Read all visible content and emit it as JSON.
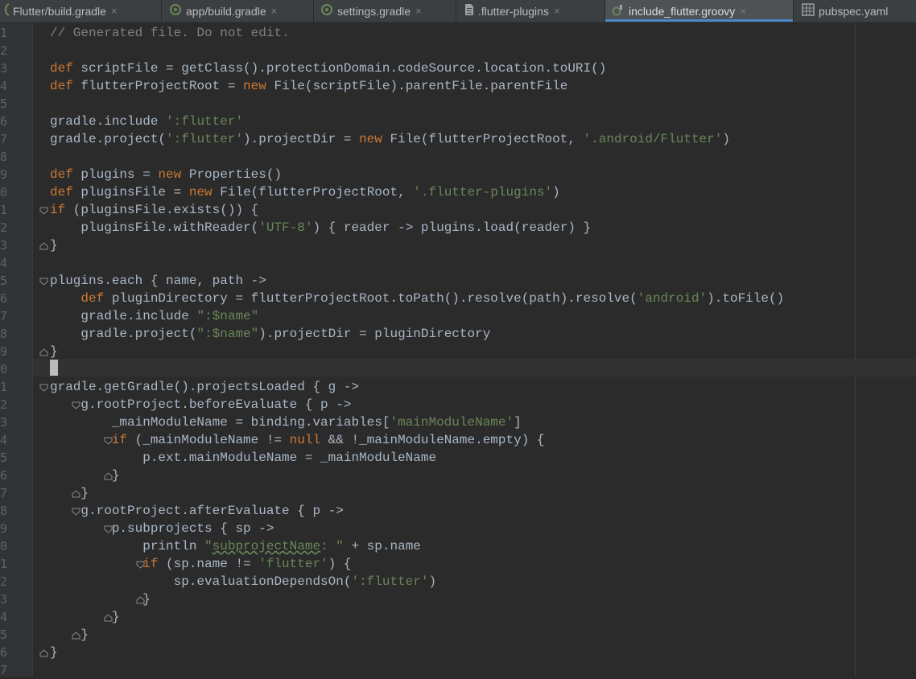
{
  "tabs": [
    {
      "label": "Flutter/build.gradle",
      "icon": "gradle-icon"
    },
    {
      "label": "app/build.gradle",
      "icon": "gradle-icon"
    },
    {
      "label": "settings.gradle",
      "icon": "gradle-icon"
    },
    {
      "label": ".flutter-plugins",
      "icon": "file-icon"
    },
    {
      "label": "include_flutter.groovy",
      "icon": "groovy-icon",
      "active": true
    },
    {
      "label": "pubspec.yaml",
      "icon": "yaml-icon"
    }
  ],
  "close_glyph": "×",
  "line_numbers": [
    "1",
    "2",
    "3",
    "4",
    "5",
    "6",
    "7",
    "8",
    "9",
    "0",
    "1",
    "2",
    "3",
    "4",
    "5",
    "6",
    "7",
    "8",
    "9",
    "0",
    "1",
    "2",
    "3",
    "4",
    "5",
    "6",
    "7",
    "8",
    "9",
    "0",
    "1",
    "2",
    "3",
    "4",
    "5",
    "6",
    "7"
  ],
  "code_lines": [
    [
      [
        "c",
        "// Generated file. Do not edit."
      ]
    ],
    [],
    [
      [
        "k",
        "def"
      ],
      [
        "p",
        " scriptFile = getClass().protectionDomain.codeSource.location.toURI()"
      ]
    ],
    [
      [
        "k",
        "def"
      ],
      [
        "p",
        " flutterProjectRoot = "
      ],
      [
        "k",
        "new"
      ],
      [
        "p",
        " File(scriptFile).parentFile.parentFile"
      ]
    ],
    [],
    [
      [
        "p",
        "gradle.include "
      ],
      [
        "s",
        "':flutter'"
      ]
    ],
    [
      [
        "p",
        "gradle.project("
      ],
      [
        "s",
        "':flutter'"
      ],
      [
        "p",
        ").projectDir = "
      ],
      [
        "k",
        "new"
      ],
      [
        "p",
        " File(flutterProjectRoot, "
      ],
      [
        "s",
        "'.android/Flutter'"
      ],
      [
        "p",
        ")"
      ]
    ],
    [],
    [
      [
        "k",
        "def"
      ],
      [
        "p",
        " plugins = "
      ],
      [
        "k",
        "new"
      ],
      [
        "p",
        " Properties()"
      ]
    ],
    [
      [
        "k",
        "def"
      ],
      [
        "p",
        " pluginsFile = "
      ],
      [
        "k",
        "new"
      ],
      [
        "p",
        " File(flutterProjectRoot, "
      ],
      [
        "s",
        "'.flutter-plugins'"
      ],
      [
        "p",
        ")"
      ]
    ],
    [
      [
        "k",
        "if"
      ],
      [
        "p",
        " (pluginsFile.exists()) {"
      ]
    ],
    [
      [
        "p",
        "    pluginsFile.withReader("
      ],
      [
        "s",
        "'UTF-8'"
      ],
      [
        "p",
        ") { reader -> plugins.load(reader) }"
      ]
    ],
    [
      [
        "p",
        "}"
      ]
    ],
    [],
    [
      [
        "p",
        "plugins.each { name, path ->"
      ]
    ],
    [
      [
        "p",
        "    "
      ],
      [
        "k",
        "def"
      ],
      [
        "p",
        " pluginDirectory = flutterProjectRoot.toPath().resolve(path).resolve("
      ],
      [
        "s",
        "'android'"
      ],
      [
        "p",
        ").toFile()"
      ]
    ],
    [
      [
        "p",
        "    gradle.include "
      ],
      [
        "s",
        "\":$name\""
      ]
    ],
    [
      [
        "p",
        "    gradle.project("
      ],
      [
        "s",
        "\":$name\""
      ],
      [
        "p",
        ").projectDir = pluginDirectory"
      ]
    ],
    [
      [
        "p",
        "}"
      ]
    ],
    [],
    [
      [
        "p",
        "gradle.getGradle().projectsLoaded { g ->"
      ]
    ],
    [
      [
        "p",
        "    g.rootProject.beforeEvaluate { p ->"
      ]
    ],
    [
      [
        "p",
        "        _mainModuleName = binding.variables["
      ],
      [
        "s",
        "'mainModuleName'"
      ],
      [
        "p",
        "]"
      ]
    ],
    [
      [
        "p",
        "        "
      ],
      [
        "k",
        "if"
      ],
      [
        "p",
        " (_mainModuleName != "
      ],
      [
        "k",
        "null"
      ],
      [
        "p",
        " && !_mainModuleName.empty) {"
      ]
    ],
    [
      [
        "p",
        "            p.ext.mainModuleName = _mainModuleName"
      ]
    ],
    [
      [
        "p",
        "        }"
      ]
    ],
    [
      [
        "p",
        "    }"
      ]
    ],
    [
      [
        "p",
        "    g.rootProject.afterEvaluate { p ->"
      ]
    ],
    [
      [
        "p",
        "        p.subprojects { sp ->"
      ]
    ],
    [
      [
        "p",
        "            println "
      ],
      [
        "s",
        "\""
      ],
      [
        "su",
        "subprojectName"
      ],
      [
        "s",
        ": \""
      ],
      [
        "p",
        " + sp.name"
      ]
    ],
    [
      [
        "p",
        "            "
      ],
      [
        "k",
        "if"
      ],
      [
        "p",
        " (sp.name != "
      ],
      [
        "s",
        "'flutter'"
      ],
      [
        "p",
        ") {"
      ]
    ],
    [
      [
        "p",
        "                sp.evaluationDependsOn("
      ],
      [
        "s",
        "':flutter'"
      ],
      [
        "p",
        ")"
      ]
    ],
    [
      [
        "p",
        "            }"
      ]
    ],
    [
      [
        "p",
        "        }"
      ]
    ],
    [
      [
        "p",
        "    }"
      ]
    ],
    [
      [
        "p",
        "}"
      ]
    ],
    []
  ],
  "caret_line_index": 19,
  "colors": {
    "keyword": "#cc7832",
    "string": "#6a8759",
    "comment": "#808080",
    "plain": "#a9b7c6",
    "background": "#2b2b2b"
  }
}
